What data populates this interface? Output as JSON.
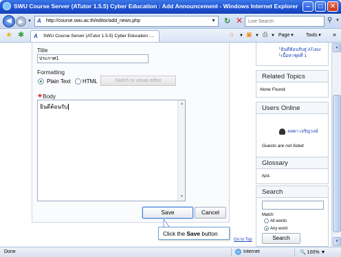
{
  "window": {
    "title": "SWU Course Server (ATutor 1.5.5) Cyber Education : Add Announcement - Windows Internet Explorer",
    "minimize": "–",
    "maximize": "□",
    "close": "✕"
  },
  "address_bar": {
    "url": "http://course.swu.ac.th/editor/add_news.php",
    "search_placeholder": "Live Search"
  },
  "tab": {
    "label": "SWU Course Server (ATutor 1.5.5) Cyber Education :..."
  },
  "command_bar": {
    "page_label": "Page ▾",
    "tools_label": "Tools ▾",
    "more": "»"
  },
  "form": {
    "title_label": "Title",
    "title_value": "ประกาศ1",
    "formatting_label": "Formatting",
    "plain_text_label": "Plain Text",
    "html_label": "HTML",
    "visual_editor_label": "Switch to visual editor",
    "required_marker": "★",
    "body_label": "Body",
    "body_value": "ยินดีต้อนรับ",
    "save_label": "Save",
    "cancel_label": "Cancel",
    "selected_format": "Plain Text"
  },
  "callout": {
    "prefix": "Click the",
    "bold": "Save",
    "suffix": "button"
  },
  "goto_top": "Go to Top",
  "sidebar": {
    "top_links": [
      "ยินดีต้อนรับสู่ ATutor",
      "เนื้อหาชุดที่ 1"
    ],
    "related_topics": {
      "heading": "Related Topics",
      "body": "None Found."
    },
    "users_online": {
      "heading": "Users Online",
      "user": "ลลดา เจริญวงษ์",
      "note": "Guests are not listed"
    },
    "glossary": {
      "heading": "Glossary",
      "body": "N/A"
    },
    "search": {
      "heading": "Search",
      "match_label": "Match:",
      "option_all": "All words",
      "option_any": "Any word",
      "button_label": "Search",
      "selected_option": "Any word"
    }
  },
  "status_bar": {
    "status": "Done",
    "zone": "Internet",
    "zoom": "100%"
  },
  "colors": {
    "title_bar": "#1d4fd0",
    "link": "#1a44b8",
    "required": "#e02020",
    "callout_border": "#6c9fd8"
  }
}
